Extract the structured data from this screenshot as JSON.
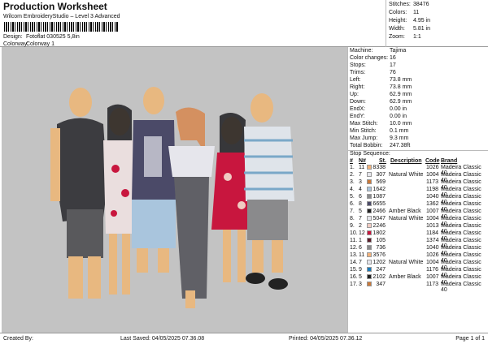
{
  "header": {
    "title": "Production Worksheet",
    "subtitle": "Wilcom EmbroideryStudio – Level 3 Advanced",
    "barcode_suffix": ",",
    "design_label": "Design:",
    "design_value": "Fotoflat 030525 5,8in",
    "colorway_label": "Colorway:",
    "colorway_value": "Colorway 1"
  },
  "stats": [
    {
      "label": "Stitches:",
      "value": "38476"
    },
    {
      "label": "Colors:",
      "value": "11"
    },
    {
      "label": "Height:",
      "value": "4.95 in"
    },
    {
      "label": "Width:",
      "value": "5.81 in"
    },
    {
      "label": "Zoom:",
      "value": "1:1"
    }
  ],
  "machine": [
    {
      "label": "Machine:",
      "value": "Tajima"
    },
    {
      "label": "Color changes:",
      "value": "16"
    },
    {
      "label": "Stops:",
      "value": "17"
    },
    {
      "label": "Trims:",
      "value": "76"
    },
    {
      "label": "Left:",
      "value": "73.8 mm"
    },
    {
      "label": "Right:",
      "value": "73.8 mm"
    },
    {
      "label": "Up:",
      "value": "62.9 mm"
    },
    {
      "label": "Down:",
      "value": "62.9 mm"
    },
    {
      "label": "EndX:",
      "value": "0.00 in"
    },
    {
      "label": "EndY:",
      "value": "0.00 in"
    },
    {
      "label": "Max Stitch:",
      "value": "10.0 mm"
    },
    {
      "label": "Min Stitch:",
      "value": "0.1 mm"
    },
    {
      "label": "Max Jump:",
      "value": "9.3 mm"
    },
    {
      "label": "Total Bobbin:",
      "value": "247.38ft"
    }
  ],
  "stop_sequence": {
    "title": "Stop Sequence:",
    "headers": {
      "num": "#",
      "n": "N#",
      "st": "St.",
      "desc": "Description",
      "code": "Code",
      "brand": "Brand"
    },
    "rows": [
      {
        "num": "1.",
        "n": "11",
        "color": "#f2b27a",
        "st": "8338",
        "desc": "",
        "code": "1026",
        "brand": "Madeira Classic 40"
      },
      {
        "num": "2.",
        "n": "7",
        "color": "#e6e6ec",
        "st": "307",
        "desc": "Natural White",
        "code": "1004",
        "brand": "Madeira Classic 40"
      },
      {
        "num": "3.",
        "n": "3",
        "color": "#c9793a",
        "st": "569",
        "desc": "",
        "code": "1173",
        "brand": "Madeira Classic 40"
      },
      {
        "num": "4.",
        "n": "4",
        "color": "#a9c5dd",
        "st": "1642",
        "desc": "",
        "code": "1198",
        "brand": "Madeira Classic 40"
      },
      {
        "num": "5.",
        "n": "6",
        "color": "#8a8a8c",
        "st": "1087",
        "desc": "",
        "code": "1040",
        "brand": "Madeira Classic 40"
      },
      {
        "num": "6.",
        "n": "8",
        "color": "#4b4a68",
        "st": "6655",
        "desc": "",
        "code": "1362",
        "brand": "Madeira Classic 40"
      },
      {
        "num": "7.",
        "n": "5",
        "color": "#222222",
        "st": "2466",
        "desc": "Amber Black",
        "code": "1007",
        "brand": "Madeira Classic 40"
      },
      {
        "num": "8.",
        "n": "7",
        "color": "#e6e6ec",
        "st": "5047",
        "desc": "Natural White",
        "code": "1004",
        "brand": "Madeira Classic 40"
      },
      {
        "num": "9.",
        "n": "2",
        "color": "#f0cbc2",
        "st": "2246",
        "desc": "",
        "code": "1013",
        "brand": "Madeira Classic 40"
      },
      {
        "num": "10.",
        "n": "12",
        "color": "#c8163e",
        "st": "1802",
        "desc": "",
        "code": "1184",
        "brand": "Madeira Classic 40"
      },
      {
        "num": "11.",
        "n": "1",
        "color": "#5a1e2a",
        "st": "105",
        "desc": "",
        "code": "1374",
        "brand": "Madeira Classic 40"
      },
      {
        "num": "12.",
        "n": "6",
        "color": "#8a8a8c",
        "st": "736",
        "desc": "",
        "code": "1040",
        "brand": "Madeira Classic 40"
      },
      {
        "num": "13.",
        "n": "11",
        "color": "#f2b27a",
        "st": "3576",
        "desc": "",
        "code": "1026",
        "brand": "Madeira Classic 40"
      },
      {
        "num": "14.",
        "n": "7",
        "color": "#e6e6ec",
        "st": "1202",
        "desc": "Natural White",
        "code": "1004",
        "brand": "Madeira Classic 40"
      },
      {
        "num": "15.",
        "n": "9",
        "color": "#1a7ab8",
        "st": "247",
        "desc": "",
        "code": "1176",
        "brand": "Madeira Classic 40"
      },
      {
        "num": "16.",
        "n": "5",
        "color": "#222222",
        "st": "2102",
        "desc": "Amber Black",
        "code": "1007",
        "brand": "Madeira Classic 40"
      },
      {
        "num": "17.",
        "n": "3",
        "color": "#c9793a",
        "st": "347",
        "desc": "",
        "code": "1173",
        "brand": "Madeira Classic 40"
      }
    ]
  },
  "footer": {
    "created_by": "Created By:",
    "last_saved": "Last Saved: 04/05/2025 07.36.08",
    "printed": "Printed: 04/05/2025 07.36.12",
    "page": "Page 1 of 1"
  }
}
